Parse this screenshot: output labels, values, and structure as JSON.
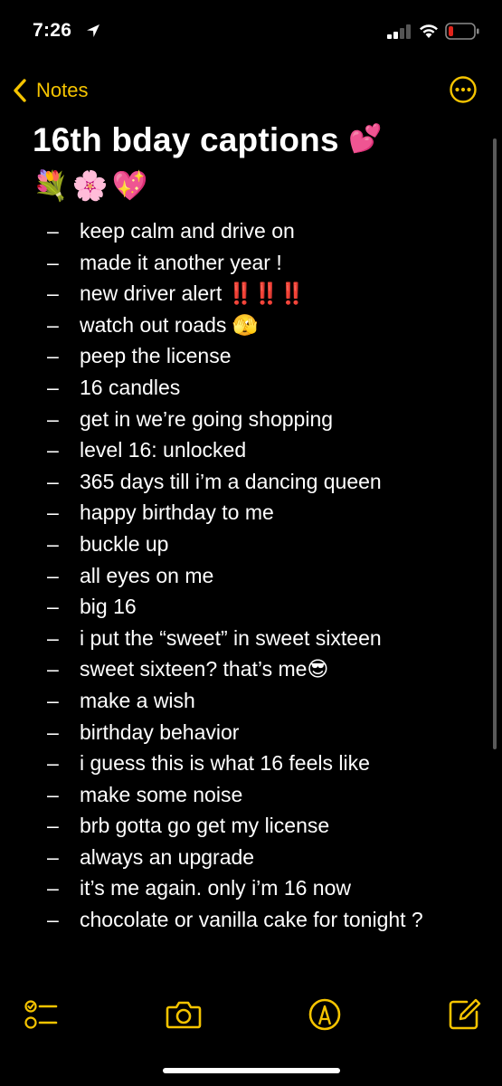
{
  "status_bar": {
    "time": "7:26"
  },
  "nav": {
    "back_label": "Notes"
  },
  "note": {
    "title": "16th bday captions",
    "title_emoji": "💕",
    "emoji_line": "💐🌸💖",
    "bullet": "–",
    "items": [
      "keep calm and drive on",
      "made it another year !",
      "new driver alert ‼️‼️‼️",
      "watch out roads 🫣",
      "peep the license",
      "16 candles",
      "get in we’re going shopping",
      "level 16: unlocked",
      "365 days till i’m a dancing queen",
      "happy birthday to me",
      "buckle up",
      "all eyes on me",
      "big 16",
      "i put the “sweet” in sweet sixteen",
      "sweet sixteen? that’s me😎",
      "make a wish",
      "birthday behavior",
      "i guess this is what 16 feels like",
      "make some noise",
      "brb gotta go get my license",
      "always an upgrade",
      "it’s me again. only i’m 16 now",
      "chocolate or vanilla cake for tonight ?"
    ]
  },
  "toolbar": {
    "icons": [
      "checklist-icon",
      "camera-icon",
      "markup-icon",
      "compose-icon"
    ]
  },
  "colors": {
    "accent": "#f5c400",
    "background": "#000000",
    "text": "#ffffff",
    "battery_low": "#e0241b"
  }
}
